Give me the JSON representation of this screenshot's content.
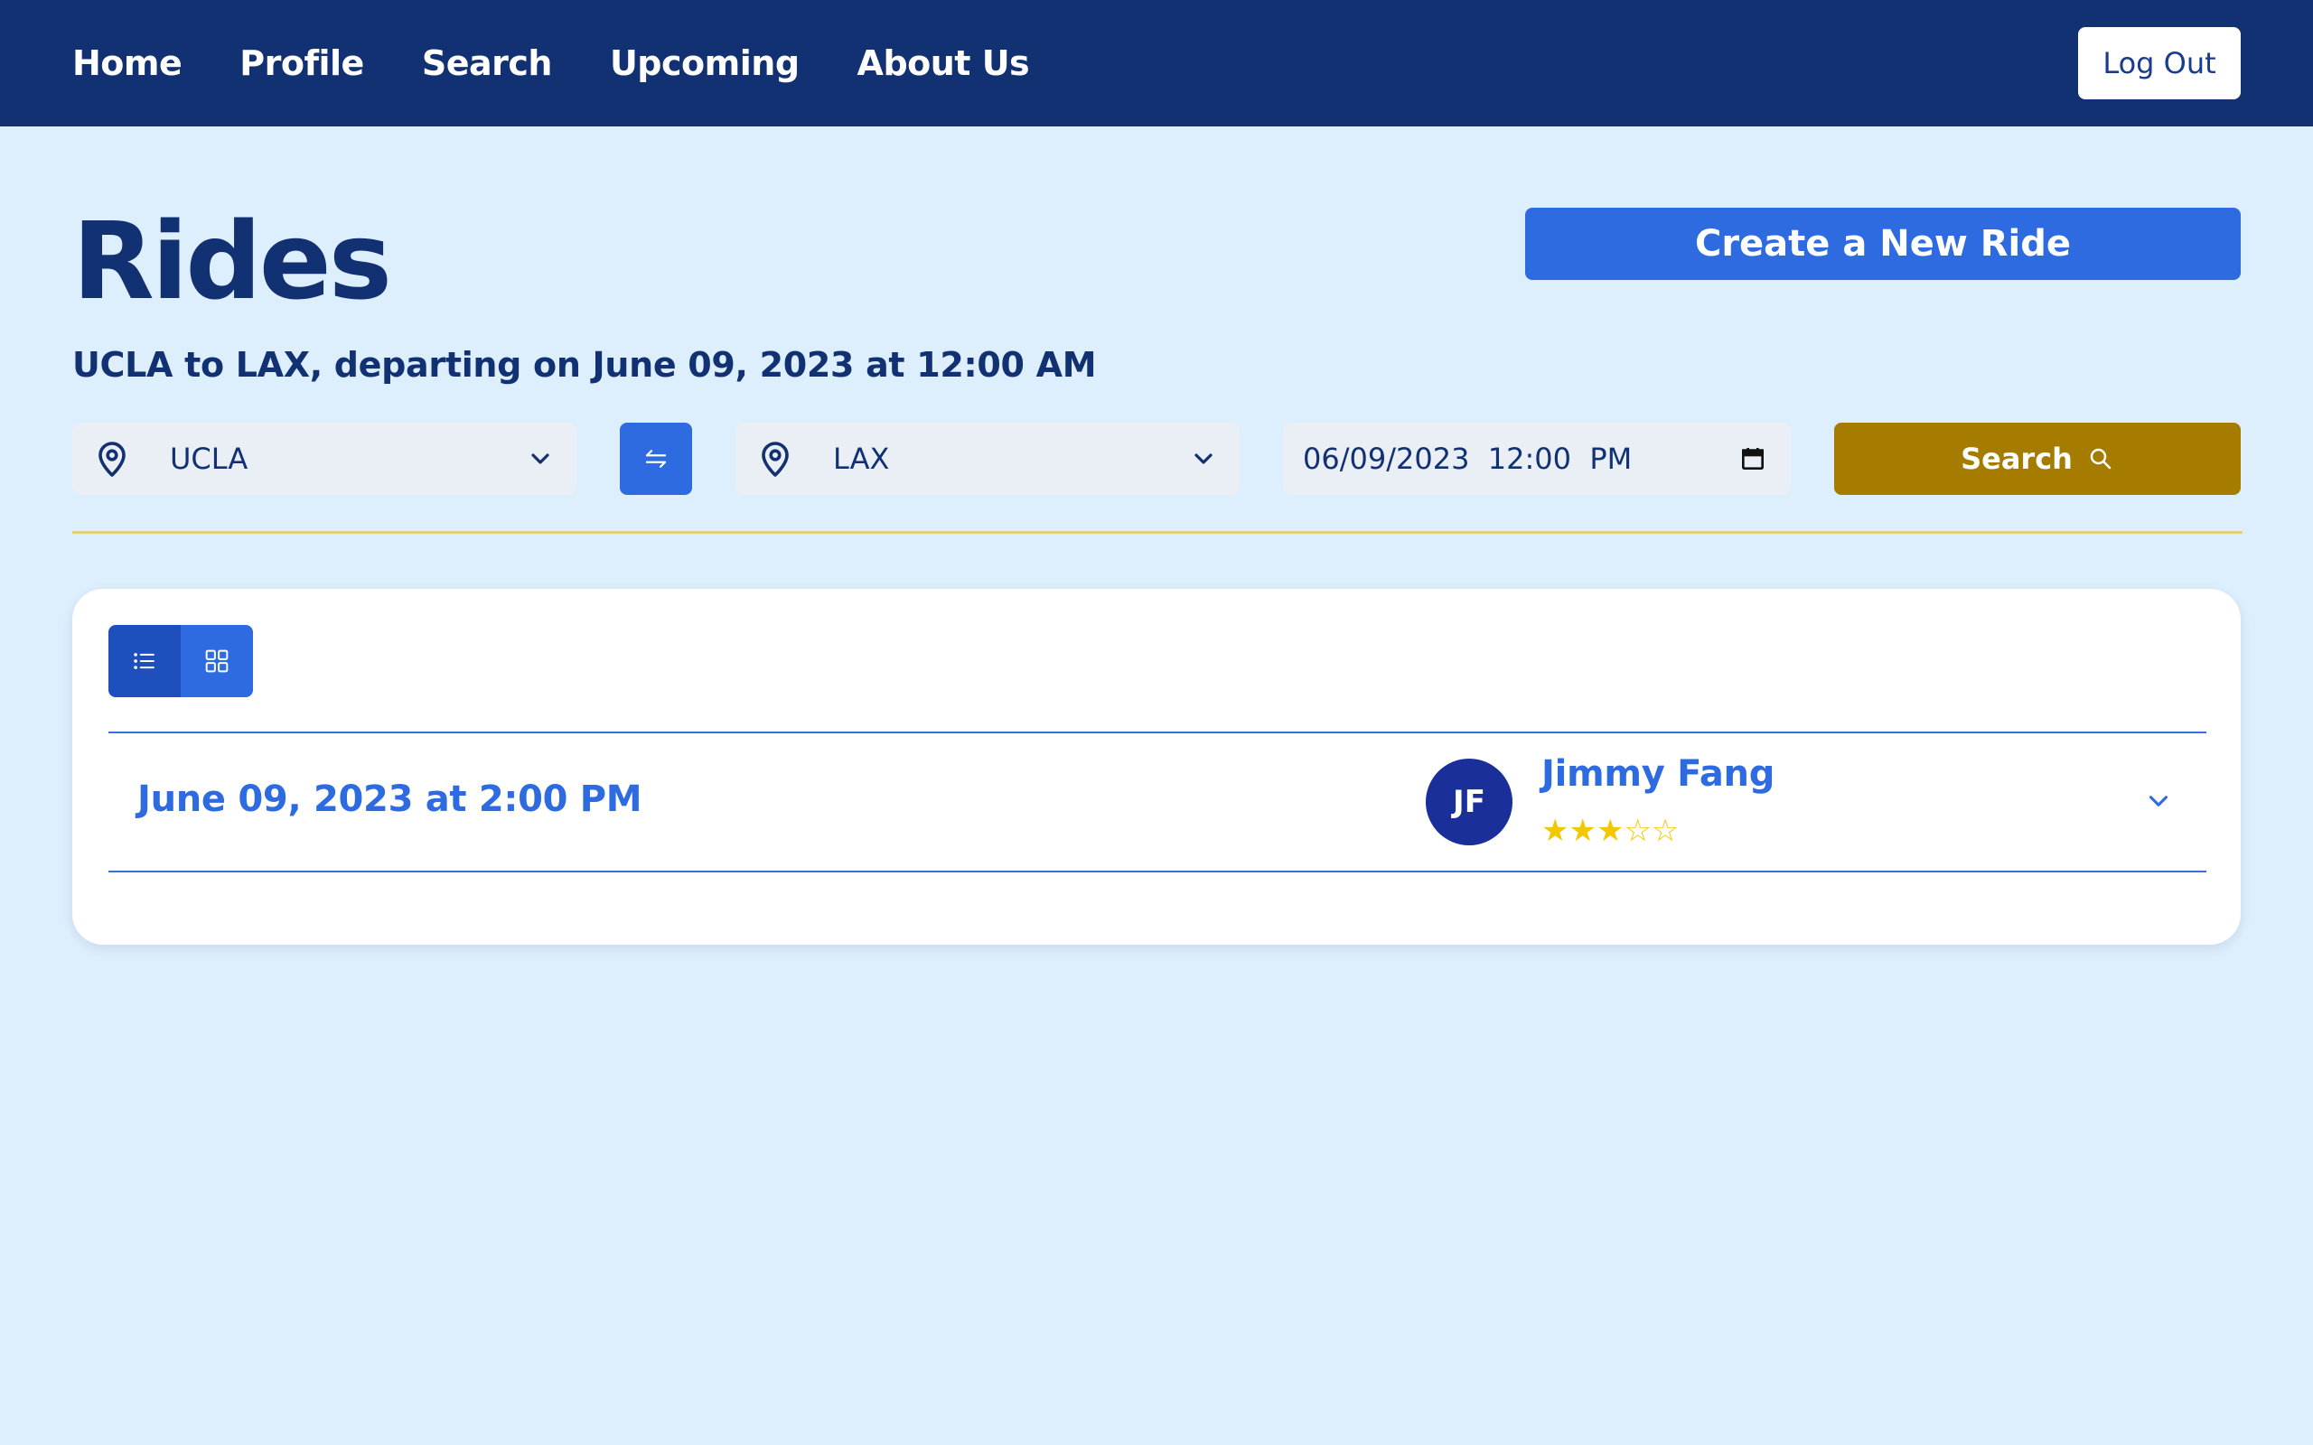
{
  "nav": {
    "links": [
      "Home",
      "Profile",
      "Search",
      "Upcoming",
      "About Us"
    ],
    "logout_label": "Log Out"
  },
  "header": {
    "title": "Rides",
    "create_label": "Create a New Ride",
    "subtitle": "UCLA to LAX, departing on June 09, 2023 at 12:00 AM"
  },
  "search": {
    "origin": "UCLA",
    "destination": "LAX",
    "datetime": "06/09/2023  12:00  PM",
    "button_label": "Search"
  },
  "icons": {
    "origin": "map-pin-icon",
    "destination": "map-pin-icon",
    "swap": "swap-arrows-icon",
    "calendar": "calendar-icon",
    "search": "magnifier-icon",
    "list_view": "list-icon",
    "grid_view": "grid-icon",
    "expand": "chevron-down-icon"
  },
  "rides": [
    {
      "date": "June 09, 2023 at 2:00 PM",
      "driver_initials": "JF",
      "driver_name": "Jimmy Fang",
      "rating_stars": "★★★☆☆",
      "rating": 3,
      "rating_max": 5
    }
  ],
  "colors": {
    "nav_bg": "#123173",
    "page_bg": "#ddeefc",
    "accent": "#2e6be0",
    "search_button": "#a67c00",
    "star": "#f3c800",
    "avatar": "#1a2f99"
  }
}
